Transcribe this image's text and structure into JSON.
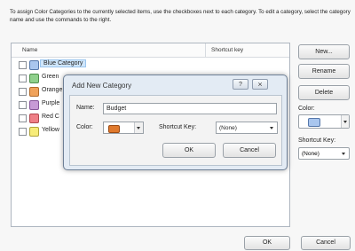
{
  "instructions": "To assign Color Categories to the currently selected items, use the checkboxes next to each category. To edit a category, select the category name and use the commands to the right.",
  "list": {
    "col_name": "Name",
    "col_shortcut": "Shortcut key",
    "rows": [
      {
        "label": "Blue Category",
        "color": "#a9c6ee",
        "selected": true
      },
      {
        "label": "Green",
        "color": "#8fd08c",
        "selected": false
      },
      {
        "label": "Orange",
        "color": "#f0a25a",
        "selected": false
      },
      {
        "label": "Purple",
        "color": "#c79ad6",
        "selected": false
      },
      {
        "label": "Red C",
        "color": "#ef7f86",
        "selected": false
      },
      {
        "label": "Yellow",
        "color": "#f7ec79",
        "selected": false
      }
    ]
  },
  "side": {
    "new_label": "New...",
    "rename_label": "Rename",
    "delete_label": "Delete",
    "color_label": "Color:",
    "shortcut_label": "Shortcut Key:",
    "shortcut_value": "(None)"
  },
  "footer": {
    "ok_label": "OK",
    "cancel_label": "Cancel"
  },
  "dialog": {
    "title": "Add New Category",
    "help_btn": "?",
    "close_btn": "⨯",
    "name_label": "Name:",
    "name_value": "Budget",
    "color_label": "Color:",
    "color_value": "#e0792c",
    "shortcut_label": "Shortcut Key:",
    "shortcut_value": "(None)",
    "ok_label": "OK",
    "cancel_label": "Cancel"
  }
}
